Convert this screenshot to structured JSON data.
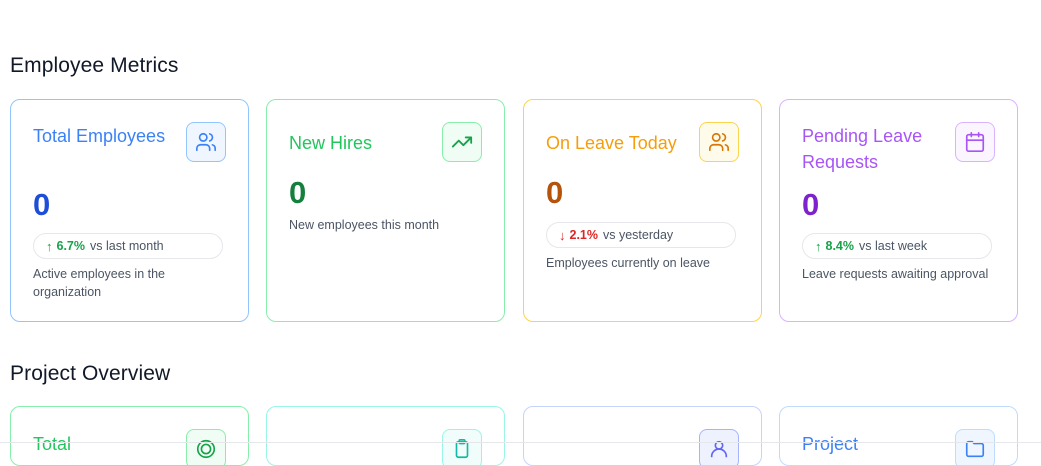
{
  "employee_metrics": {
    "heading": "Employee Metrics",
    "cards": [
      {
        "title": "Total Employees",
        "value": "0",
        "trend": {
          "direction": "up",
          "percent": "6.7%",
          "label": "vs last month"
        },
        "description": "Active employees in the organization",
        "icon": "users-icon",
        "accent": "#3b82f6"
      },
      {
        "title": "New Hires",
        "value": "0",
        "description": "New employees this month",
        "icon": "trending-up-icon",
        "accent": "#22c55e"
      },
      {
        "title": "On Leave Today",
        "value": "0",
        "trend": {
          "direction": "down",
          "percent": "2.1%",
          "label": "vs yesterday"
        },
        "description": "Employees currently on leave",
        "icon": "users-icon",
        "accent": "#f59e0b"
      },
      {
        "title": "Pending Leave Requests",
        "value": "0",
        "trend": {
          "direction": "up",
          "percent": "8.4%",
          "label": "vs last week"
        },
        "description": "Leave requests awaiting approval",
        "icon": "calendar-icon",
        "accent": "#a855f7"
      }
    ]
  },
  "project_overview": {
    "heading": "Project Overview",
    "cards": [
      {
        "title": "Total",
        "icon": "target-icon",
        "accent": "#22c55e"
      },
      {
        "title": "",
        "icon": "clipboard-icon",
        "accent": "#2dd4bf"
      },
      {
        "title": "",
        "icon": "user-icon",
        "accent": "#6366f1"
      },
      {
        "title": "Project",
        "icon": "folder-icon",
        "accent": "#3b82f6"
      }
    ]
  },
  "colors": {
    "up": "#16a34a",
    "down": "#dc2626",
    "blue_value": "#1d4ed8",
    "green_value": "#15803d",
    "orange_value": "#b45309",
    "purple_value": "#7e22ce"
  }
}
